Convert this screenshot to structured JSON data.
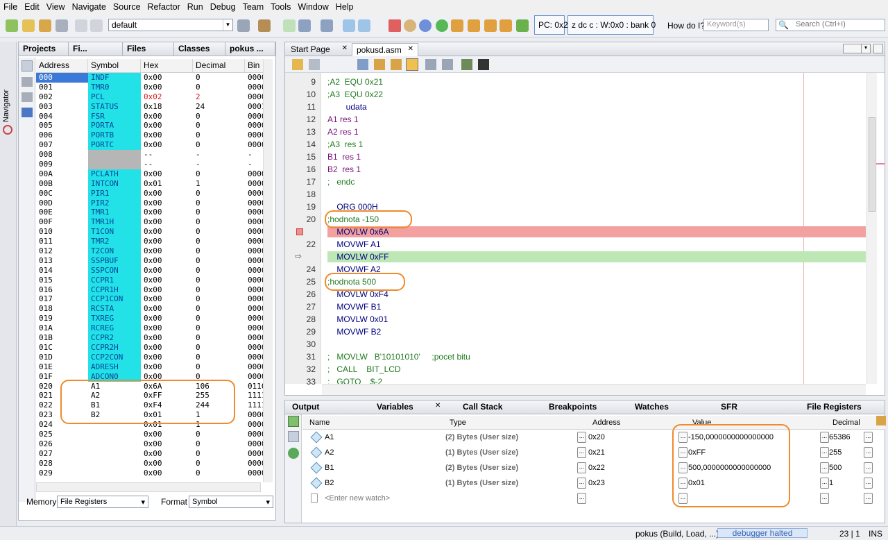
{
  "menu": [
    "File",
    "Edit",
    "View",
    "Navigate",
    "Source",
    "Refactor",
    "Run",
    "Debug",
    "Team",
    "Tools",
    "Window",
    "Help"
  ],
  "toolbar": {
    "config": "default",
    "pc": "PC: 0x2",
    "status": "z dc c  : W:0x0 : bank 0",
    "howdoi": "How do I?",
    "howdoi_placeholder": "Keyword(s)",
    "search_placeholder": "Search (Ctrl+I)"
  },
  "navigator_label": "Navigator",
  "left_tabs": [
    "Projects",
    "Fi...",
    "Files",
    "Classes",
    "pokus ..."
  ],
  "reg_headers": [
    "Address",
    "Symbol",
    "Hex",
    "Decimal",
    "Bin"
  ],
  "registers": [
    {
      "addr": "000",
      "sym": "INDF",
      "hex": "0x00",
      "dec": "0",
      "bin": "0000"
    },
    {
      "addr": "001",
      "sym": "TMR0",
      "hex": "0x00",
      "dec": "0",
      "bin": "0000"
    },
    {
      "addr": "002",
      "sym": "PCL",
      "hex": "0x02",
      "dec": "2",
      "bin": "0000"
    },
    {
      "addr": "003",
      "sym": "STATUS",
      "hex": "0x18",
      "dec": "24",
      "bin": "0001"
    },
    {
      "addr": "004",
      "sym": "FSR",
      "hex": "0x00",
      "dec": "0",
      "bin": "0000"
    },
    {
      "addr": "005",
      "sym": "PORTA",
      "hex": "0x00",
      "dec": "0",
      "bin": "0000"
    },
    {
      "addr": "006",
      "sym": "PORTB",
      "hex": "0x00",
      "dec": "0",
      "bin": "0000"
    },
    {
      "addr": "007",
      "sym": "PORTC",
      "hex": "0x00",
      "dec": "0",
      "bin": "0000"
    },
    {
      "addr": "008",
      "sym": "",
      "hex": "--",
      "dec": "-",
      "bin": "-"
    },
    {
      "addr": "009",
      "sym": "",
      "hex": "--",
      "dec": "-",
      "bin": "-"
    },
    {
      "addr": "00A",
      "sym": "PCLATH",
      "hex": "0x00",
      "dec": "0",
      "bin": "0000"
    },
    {
      "addr": "00B",
      "sym": "INTCON",
      "hex": "0x01",
      "dec": "1",
      "bin": "0000"
    },
    {
      "addr": "00C",
      "sym": "PIR1",
      "hex": "0x00",
      "dec": "0",
      "bin": "0000"
    },
    {
      "addr": "00D",
      "sym": "PIR2",
      "hex": "0x00",
      "dec": "0",
      "bin": "0000"
    },
    {
      "addr": "00E",
      "sym": "TMR1",
      "hex": "0x00",
      "dec": "0",
      "bin": "0000"
    },
    {
      "addr": "00F",
      "sym": "TMR1H",
      "hex": "0x00",
      "dec": "0",
      "bin": "0000"
    },
    {
      "addr": "010",
      "sym": "T1CON",
      "hex": "0x00",
      "dec": "0",
      "bin": "0000"
    },
    {
      "addr": "011",
      "sym": "TMR2",
      "hex": "0x00",
      "dec": "0",
      "bin": "0000"
    },
    {
      "addr": "012",
      "sym": "T2CON",
      "hex": "0x00",
      "dec": "0",
      "bin": "0000"
    },
    {
      "addr": "013",
      "sym": "SSPBUF",
      "hex": "0x00",
      "dec": "0",
      "bin": "0000"
    },
    {
      "addr": "014",
      "sym": "SSPCON",
      "hex": "0x00",
      "dec": "0",
      "bin": "0000"
    },
    {
      "addr": "015",
      "sym": "CCPR1",
      "hex": "0x00",
      "dec": "0",
      "bin": "0000"
    },
    {
      "addr": "016",
      "sym": "CCPR1H",
      "hex": "0x00",
      "dec": "0",
      "bin": "0000"
    },
    {
      "addr": "017",
      "sym": "CCP1CON",
      "hex": "0x00",
      "dec": "0",
      "bin": "0000"
    },
    {
      "addr": "018",
      "sym": "RCSTA",
      "hex": "0x00",
      "dec": "0",
      "bin": "0000"
    },
    {
      "addr": "019",
      "sym": "TXREG",
      "hex": "0x00",
      "dec": "0",
      "bin": "0000"
    },
    {
      "addr": "01A",
      "sym": "RCREG",
      "hex": "0x00",
      "dec": "0",
      "bin": "0000"
    },
    {
      "addr": "01B",
      "sym": "CCPR2",
      "hex": "0x00",
      "dec": "0",
      "bin": "0000"
    },
    {
      "addr": "01C",
      "sym": "CCPR2H",
      "hex": "0x00",
      "dec": "0",
      "bin": "0000"
    },
    {
      "addr": "01D",
      "sym": "CCP2CON",
      "hex": "0x00",
      "dec": "0",
      "bin": "0000"
    },
    {
      "addr": "01E",
      "sym": "ADRESH",
      "hex": "0x00",
      "dec": "0",
      "bin": "0000"
    },
    {
      "addr": "01F",
      "sym": "ADCON0",
      "hex": "0x00",
      "dec": "0",
      "bin": "0000"
    },
    {
      "addr": "020",
      "sym": "A1",
      "hex": "0x6A",
      "dec": "106",
      "bin": "0110"
    },
    {
      "addr": "021",
      "sym": "A2",
      "hex": "0xFF",
      "dec": "255",
      "bin": "1111"
    },
    {
      "addr": "022",
      "sym": "B1",
      "hex": "0xF4",
      "dec": "244",
      "bin": "1111"
    },
    {
      "addr": "023",
      "sym": "B2",
      "hex": "0x01",
      "dec": "1",
      "bin": "0000"
    },
    {
      "addr": "024",
      "sym": "",
      "hex": "0x01",
      "dec": "1",
      "bin": "0000"
    },
    {
      "addr": "025",
      "sym": "",
      "hex": "0x00",
      "dec": "0",
      "bin": "0000"
    },
    {
      "addr": "026",
      "sym": "",
      "hex": "0x00",
      "dec": "0",
      "bin": "0000"
    },
    {
      "addr": "027",
      "sym": "",
      "hex": "0x00",
      "dec": "0",
      "bin": "0000"
    },
    {
      "addr": "028",
      "sym": "",
      "hex": "0x00",
      "dec": "0",
      "bin": "0000"
    },
    {
      "addr": "029",
      "sym": "",
      "hex": "0x00",
      "dec": "0",
      "bin": "0000"
    }
  ],
  "left_footer": {
    "memory_label": "Memory",
    "memory_value": "File Registers",
    "format_label": "Format",
    "format_value": "Symbol"
  },
  "editor_tabs": [
    "Start Page",
    "pokusd.asm"
  ],
  "code_lines": [
    {
      "n": "9",
      "t": ";A2  EQU 0x21",
      "k": "cm"
    },
    {
      "n": "10",
      "t": ";A3  EQU 0x22",
      "k": "cm"
    },
    {
      "n": "11",
      "t": "        udata",
      "k": ""
    },
    {
      "n": "12",
      "t": "A1 res 1",
      "k": "lab"
    },
    {
      "n": "13",
      "t": "A2 res 1",
      "k": "lab"
    },
    {
      "n": "14",
      "t": ";A3  res 1",
      "k": "cm"
    },
    {
      "n": "15",
      "t": "B1  res 1",
      "k": "lab"
    },
    {
      "n": "16",
      "t": "B2  res 1",
      "k": "lab"
    },
    {
      "n": "17",
      "t": ";   endc",
      "k": "cm"
    },
    {
      "n": "18",
      "t": "",
      "k": ""
    },
    {
      "n": "19",
      "t": "    ORG 000H",
      "k": ""
    },
    {
      "n": "20",
      "t": ";hodnota -150",
      "k": "cm"
    },
    {
      "n": "",
      "t": "    MOVLW 0x6A",
      "k": ""
    },
    {
      "n": "22",
      "t": "    MOVWF A1",
      "k": ""
    },
    {
      "n": "",
      "t": "    MOVLW 0xFF",
      "k": ""
    },
    {
      "n": "24",
      "t": "    MOVWF A2",
      "k": ""
    },
    {
      "n": "25",
      "t": ";hodnota 500",
      "k": "cm"
    },
    {
      "n": "26",
      "t": "    MOVLW 0xF4",
      "k": ""
    },
    {
      "n": "27",
      "t": "    MOVWF B1",
      "k": ""
    },
    {
      "n": "28",
      "t": "    MOVLW 0x01",
      "k": ""
    },
    {
      "n": "29",
      "t": "    MOVWF B2",
      "k": ""
    },
    {
      "n": "30",
      "t": "",
      "k": ""
    },
    {
      "n": "31",
      "t": ";   MOVLW   B'10101010'     ;pocet bitu",
      "k": "cm"
    },
    {
      "n": "32",
      "t": ";   CALL    BIT_LCD",
      "k": "cm"
    },
    {
      "n": "33",
      "t": ";   GOTO    $-2",
      "k": "cm"
    }
  ],
  "bottom_tabs": [
    "Output",
    "Variables",
    "Call Stack",
    "Breakpoints",
    "Watches",
    "SFR",
    "File Registers"
  ],
  "var_headers": [
    "Name",
    "Type",
    "Address",
    "Value",
    "Decimal"
  ],
  "variables": [
    {
      "name": "A1",
      "type": "(2) Bytes (User size)",
      "addr": "0x20",
      "value": "-150,0000000000000000",
      "dec": "65386"
    },
    {
      "name": "A2",
      "type": "(1) Bytes (User size)",
      "addr": "0x21",
      "value": "0xFF",
      "dec": "255"
    },
    {
      "name": "B1",
      "type": "(2) Bytes (User size)",
      "addr": "0x22",
      "value": "500,0000000000000000",
      "dec": "500"
    },
    {
      "name": "B2",
      "type": "(1) Bytes (User size)",
      "addr": "0x23",
      "value": "0x01",
      "dec": "1"
    }
  ],
  "new_watch": "<Enter new watch>",
  "status": {
    "build": "pokus (Build, Load, ...)",
    "debugger": "debugger halted",
    "pos": "23 | 1",
    "mode": "INS"
  }
}
